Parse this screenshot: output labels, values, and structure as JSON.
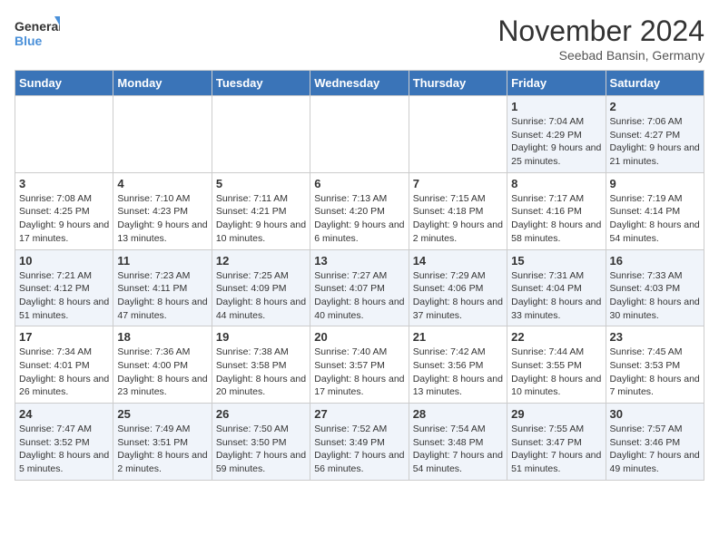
{
  "logo": {
    "line1": "General",
    "line2": "Blue"
  },
  "title": "November 2024",
  "subtitle": "Seebad Bansin, Germany",
  "days_of_week": [
    "Sunday",
    "Monday",
    "Tuesday",
    "Wednesday",
    "Thursday",
    "Friday",
    "Saturday"
  ],
  "weeks": [
    [
      {
        "day": "",
        "info": ""
      },
      {
        "day": "",
        "info": ""
      },
      {
        "day": "",
        "info": ""
      },
      {
        "day": "",
        "info": ""
      },
      {
        "day": "",
        "info": ""
      },
      {
        "day": "1",
        "info": "Sunrise: 7:04 AM\nSunset: 4:29 PM\nDaylight: 9 hours and 25 minutes."
      },
      {
        "day": "2",
        "info": "Sunrise: 7:06 AM\nSunset: 4:27 PM\nDaylight: 9 hours and 21 minutes."
      }
    ],
    [
      {
        "day": "3",
        "info": "Sunrise: 7:08 AM\nSunset: 4:25 PM\nDaylight: 9 hours and 17 minutes."
      },
      {
        "day": "4",
        "info": "Sunrise: 7:10 AM\nSunset: 4:23 PM\nDaylight: 9 hours and 13 minutes."
      },
      {
        "day": "5",
        "info": "Sunrise: 7:11 AM\nSunset: 4:21 PM\nDaylight: 9 hours and 10 minutes."
      },
      {
        "day": "6",
        "info": "Sunrise: 7:13 AM\nSunset: 4:20 PM\nDaylight: 9 hours and 6 minutes."
      },
      {
        "day": "7",
        "info": "Sunrise: 7:15 AM\nSunset: 4:18 PM\nDaylight: 9 hours and 2 minutes."
      },
      {
        "day": "8",
        "info": "Sunrise: 7:17 AM\nSunset: 4:16 PM\nDaylight: 8 hours and 58 minutes."
      },
      {
        "day": "9",
        "info": "Sunrise: 7:19 AM\nSunset: 4:14 PM\nDaylight: 8 hours and 54 minutes."
      }
    ],
    [
      {
        "day": "10",
        "info": "Sunrise: 7:21 AM\nSunset: 4:12 PM\nDaylight: 8 hours and 51 minutes."
      },
      {
        "day": "11",
        "info": "Sunrise: 7:23 AM\nSunset: 4:11 PM\nDaylight: 8 hours and 47 minutes."
      },
      {
        "day": "12",
        "info": "Sunrise: 7:25 AM\nSunset: 4:09 PM\nDaylight: 8 hours and 44 minutes."
      },
      {
        "day": "13",
        "info": "Sunrise: 7:27 AM\nSunset: 4:07 PM\nDaylight: 8 hours and 40 minutes."
      },
      {
        "day": "14",
        "info": "Sunrise: 7:29 AM\nSunset: 4:06 PM\nDaylight: 8 hours and 37 minutes."
      },
      {
        "day": "15",
        "info": "Sunrise: 7:31 AM\nSunset: 4:04 PM\nDaylight: 8 hours and 33 minutes."
      },
      {
        "day": "16",
        "info": "Sunrise: 7:33 AM\nSunset: 4:03 PM\nDaylight: 8 hours and 30 minutes."
      }
    ],
    [
      {
        "day": "17",
        "info": "Sunrise: 7:34 AM\nSunset: 4:01 PM\nDaylight: 8 hours and 26 minutes."
      },
      {
        "day": "18",
        "info": "Sunrise: 7:36 AM\nSunset: 4:00 PM\nDaylight: 8 hours and 23 minutes."
      },
      {
        "day": "19",
        "info": "Sunrise: 7:38 AM\nSunset: 3:58 PM\nDaylight: 8 hours and 20 minutes."
      },
      {
        "day": "20",
        "info": "Sunrise: 7:40 AM\nSunset: 3:57 PM\nDaylight: 8 hours and 17 minutes."
      },
      {
        "day": "21",
        "info": "Sunrise: 7:42 AM\nSunset: 3:56 PM\nDaylight: 8 hours and 13 minutes."
      },
      {
        "day": "22",
        "info": "Sunrise: 7:44 AM\nSunset: 3:55 PM\nDaylight: 8 hours and 10 minutes."
      },
      {
        "day": "23",
        "info": "Sunrise: 7:45 AM\nSunset: 3:53 PM\nDaylight: 8 hours and 7 minutes."
      }
    ],
    [
      {
        "day": "24",
        "info": "Sunrise: 7:47 AM\nSunset: 3:52 PM\nDaylight: 8 hours and 5 minutes."
      },
      {
        "day": "25",
        "info": "Sunrise: 7:49 AM\nSunset: 3:51 PM\nDaylight: 8 hours and 2 minutes."
      },
      {
        "day": "26",
        "info": "Sunrise: 7:50 AM\nSunset: 3:50 PM\nDaylight: 7 hours and 59 minutes."
      },
      {
        "day": "27",
        "info": "Sunrise: 7:52 AM\nSunset: 3:49 PM\nDaylight: 7 hours and 56 minutes."
      },
      {
        "day": "28",
        "info": "Sunrise: 7:54 AM\nSunset: 3:48 PM\nDaylight: 7 hours and 54 minutes."
      },
      {
        "day": "29",
        "info": "Sunrise: 7:55 AM\nSunset: 3:47 PM\nDaylight: 7 hours and 51 minutes."
      },
      {
        "day": "30",
        "info": "Sunrise: 7:57 AM\nSunset: 3:46 PM\nDaylight: 7 hours and 49 minutes."
      }
    ]
  ]
}
